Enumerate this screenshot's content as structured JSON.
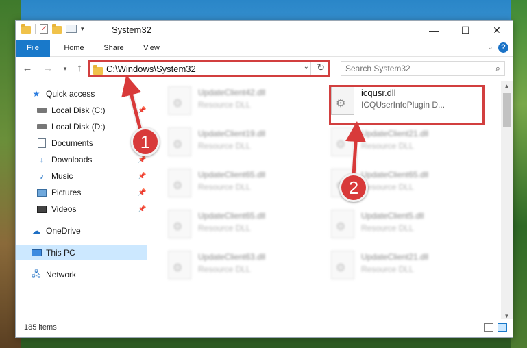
{
  "window": {
    "title": "System32",
    "controls": {
      "minimize": "—",
      "maximize": "☐",
      "close": "✕"
    }
  },
  "ribbon": {
    "tabs": [
      {
        "label": "File",
        "active": true
      },
      {
        "label": "Home"
      },
      {
        "label": "Share"
      },
      {
        "label": "View"
      }
    ]
  },
  "address": {
    "path": "C:\\Windows\\System32",
    "search_placeholder": "Search System32"
  },
  "sidebar": {
    "items": [
      {
        "label": "Quick access",
        "icon": "star-icon"
      },
      {
        "label": "Local Disk (C:)",
        "icon": "drive-icon",
        "pinned": true
      },
      {
        "label": "Local Disk (D:)",
        "icon": "drive-icon"
      },
      {
        "label": "Documents",
        "icon": "documents-icon",
        "pinned": true
      },
      {
        "label": "Downloads",
        "icon": "download-icon",
        "pinned": true
      },
      {
        "label": "Music",
        "icon": "music-icon",
        "pinned": true
      },
      {
        "label": "Pictures",
        "icon": "pictures-icon",
        "pinned": true
      },
      {
        "label": "Videos",
        "icon": "videos-icon",
        "pinned": true
      },
      {
        "label": "OneDrive",
        "icon": "cloud-icon"
      },
      {
        "label": "This PC",
        "icon": "computer-icon",
        "selected": true
      },
      {
        "label": "Network",
        "icon": "network-icon"
      }
    ]
  },
  "files": {
    "left_column": [
      {
        "name": "UpdateClient42.dll",
        "type": "Resource DLL"
      },
      {
        "name": "UpdateClient19.dll",
        "type": "Resource DLL"
      },
      {
        "name": "UpdateClient65.dll",
        "type": "Resource DLL"
      },
      {
        "name": "UpdateClient65.dll",
        "type": "Resource DLL"
      },
      {
        "name": "UpdateClient63.dll",
        "type": "Resource DLL"
      }
    ],
    "right_column": [
      {
        "name": "icqusr.dll",
        "type": "ICQUserInfoPlugin D...",
        "highlighted": true
      },
      {
        "name": "UpdateClient21.dll",
        "type": "Resource DLL"
      },
      {
        "name": "UpdateClient65.dll",
        "type": "Resource DLL"
      },
      {
        "name": "UpdateClient5.dll",
        "type": "Resource DLL"
      },
      {
        "name": "UpdateClient21.dll",
        "type": "Resource DLL"
      }
    ]
  },
  "status": {
    "item_count": "185 items"
  },
  "annotations": {
    "callouts": [
      {
        "label": "1"
      },
      {
        "label": "2"
      }
    ],
    "accent_color": "#d23f3f"
  },
  "colors": {
    "file_tab": "#1979ca",
    "selection": "#cce8ff"
  }
}
